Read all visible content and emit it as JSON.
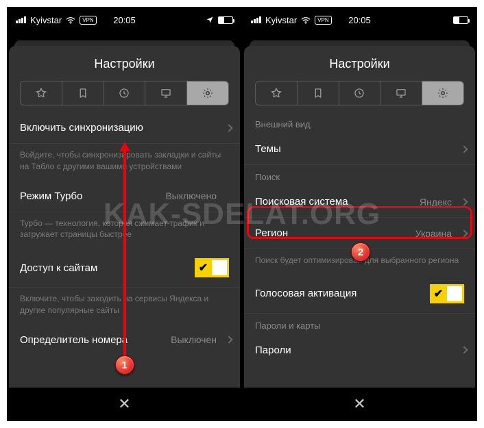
{
  "watermark": "KAK-SDELAT.ORG",
  "status": {
    "carrier": "Kyivstar",
    "vpn": "VPN",
    "time": "20:05"
  },
  "header": "Настройки",
  "tabs": {
    "star": "star-icon",
    "bookmark": "bookmark-icon",
    "history": "history-icon",
    "display": "display-icon",
    "gear": "gear-icon"
  },
  "left": {
    "sync": {
      "label": "Включить синхронизацию"
    },
    "sync_desc": "Войдите, чтобы синхронизировать закладки и сайты на Табло с другими вашими устройствами",
    "turbo": {
      "label": "Режим Турбо",
      "value": "Выключено"
    },
    "turbo_desc": "Турбо — технология, которая сжимает трафик и загружает страницы быстрее",
    "access": {
      "label": "Доступ к сайтам"
    },
    "access_desc": "Включите, чтобы заходить на сервисы Яндекса и другие популярные сайты",
    "callerid": {
      "label": "Определитель номера",
      "value": "Выключен"
    }
  },
  "right": {
    "sections": {
      "appearance": "Внешний вид",
      "search": "Поиск",
      "passwords": "Пароли и карты"
    },
    "themes": {
      "label": "Темы"
    },
    "search_engine": {
      "label": "Поисковая система",
      "value": "Яндекс"
    },
    "region": {
      "label": "Регион",
      "value": "Украина"
    },
    "region_desc": "Поиск будет оптимизирован для выбранного региона",
    "voice": {
      "label": "Голосовая активация"
    },
    "passwords_row": {
      "label": "Пароли"
    }
  },
  "steps": {
    "one": "1",
    "two": "2"
  },
  "close": "✕"
}
